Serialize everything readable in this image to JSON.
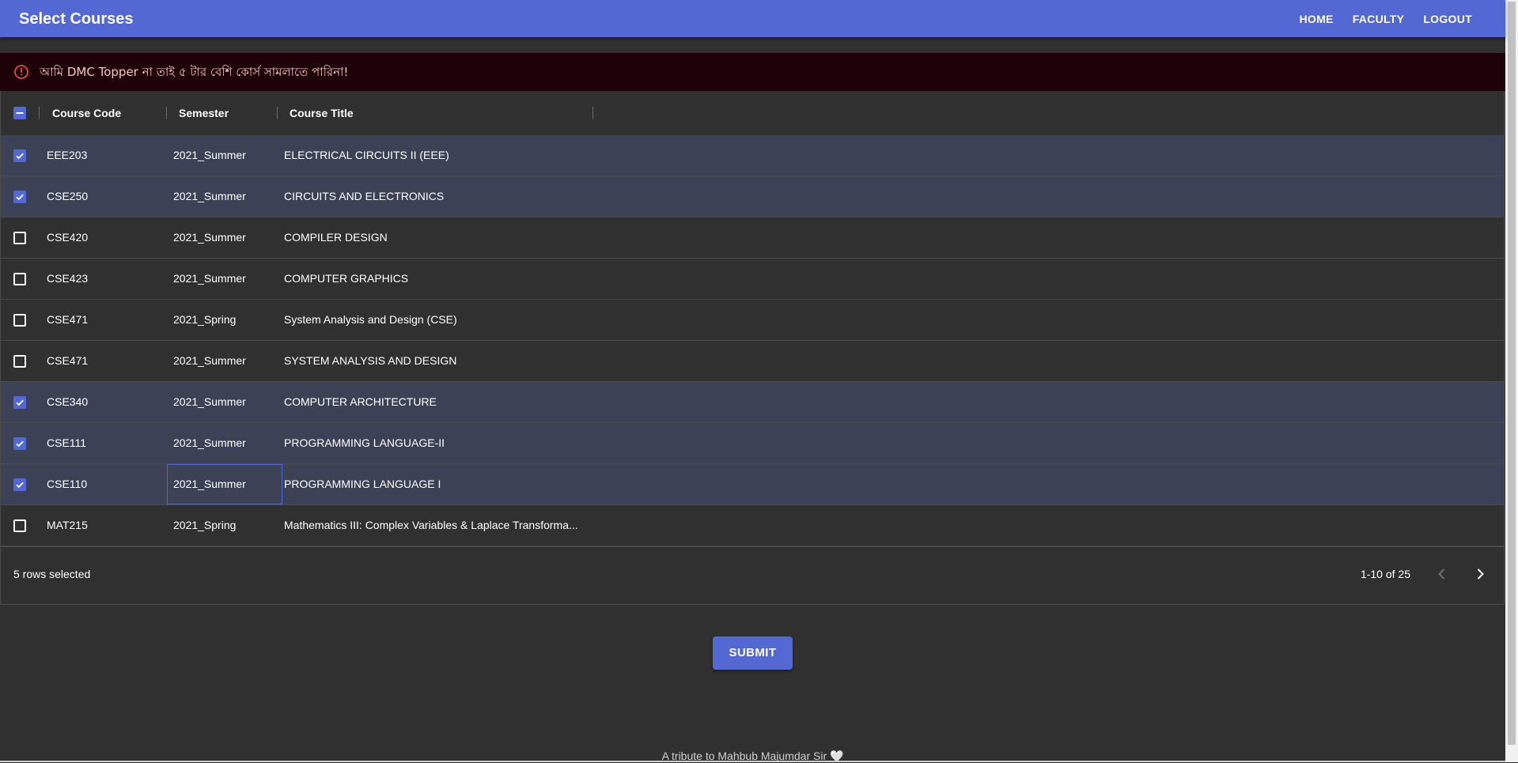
{
  "appbar": {
    "title": "Select Courses",
    "nav": [
      "HOME",
      "FACULTY",
      "LOGOUT"
    ],
    "color": "#5468d4"
  },
  "alert": {
    "icon": "error-outline-icon",
    "text": "আমি DMC Topper না তাই ৫ টার বেশি কোর্স সামলাতে পারিনা!"
  },
  "table": {
    "columns": [
      "Course Code",
      "Semester",
      "Course Title"
    ],
    "rows": [
      {
        "code": "EEE203",
        "semester": "2021_Summer",
        "title": "ELECTRICAL CIRCUITS II (EEE)",
        "selected": true
      },
      {
        "code": "CSE250",
        "semester": "2021_Summer",
        "title": "CIRCUITS AND ELECTRONICS",
        "selected": true
      },
      {
        "code": "CSE420",
        "semester": "2021_Summer",
        "title": "COMPILER DESIGN",
        "selected": false
      },
      {
        "code": "CSE423",
        "semester": "2021_Summer",
        "title": "COMPUTER GRAPHICS",
        "selected": false
      },
      {
        "code": "CSE471",
        "semester": "2021_Spring",
        "title": "System Analysis and Design (CSE)",
        "selected": false
      },
      {
        "code": "CSE471",
        "semester": "2021_Summer",
        "title": "SYSTEM ANALYSIS AND DESIGN",
        "selected": false
      },
      {
        "code": "CSE340",
        "semester": "2021_Summer",
        "title": "COMPUTER ARCHITECTURE",
        "selected": true
      },
      {
        "code": "CSE111",
        "semester": "2021_Summer",
        "title": "PROGRAMMING LANGUAGE-II",
        "selected": true
      },
      {
        "code": "CSE110",
        "semester": "2021_Summer",
        "title": "PROGRAMMING LANGUAGE I",
        "selected": true
      },
      {
        "code": "MAT215",
        "semester": "2021_Spring",
        "title": "Mathematics III: Complex Variables & Laplace Transforma...",
        "selected": false
      }
    ],
    "selected_text": "5 rows selected",
    "pagination_text": "1-10 of 25"
  },
  "submit_label": "SUBMIT",
  "footer_text": "A tribute to Mahbub Majumdar Sir 🤍"
}
